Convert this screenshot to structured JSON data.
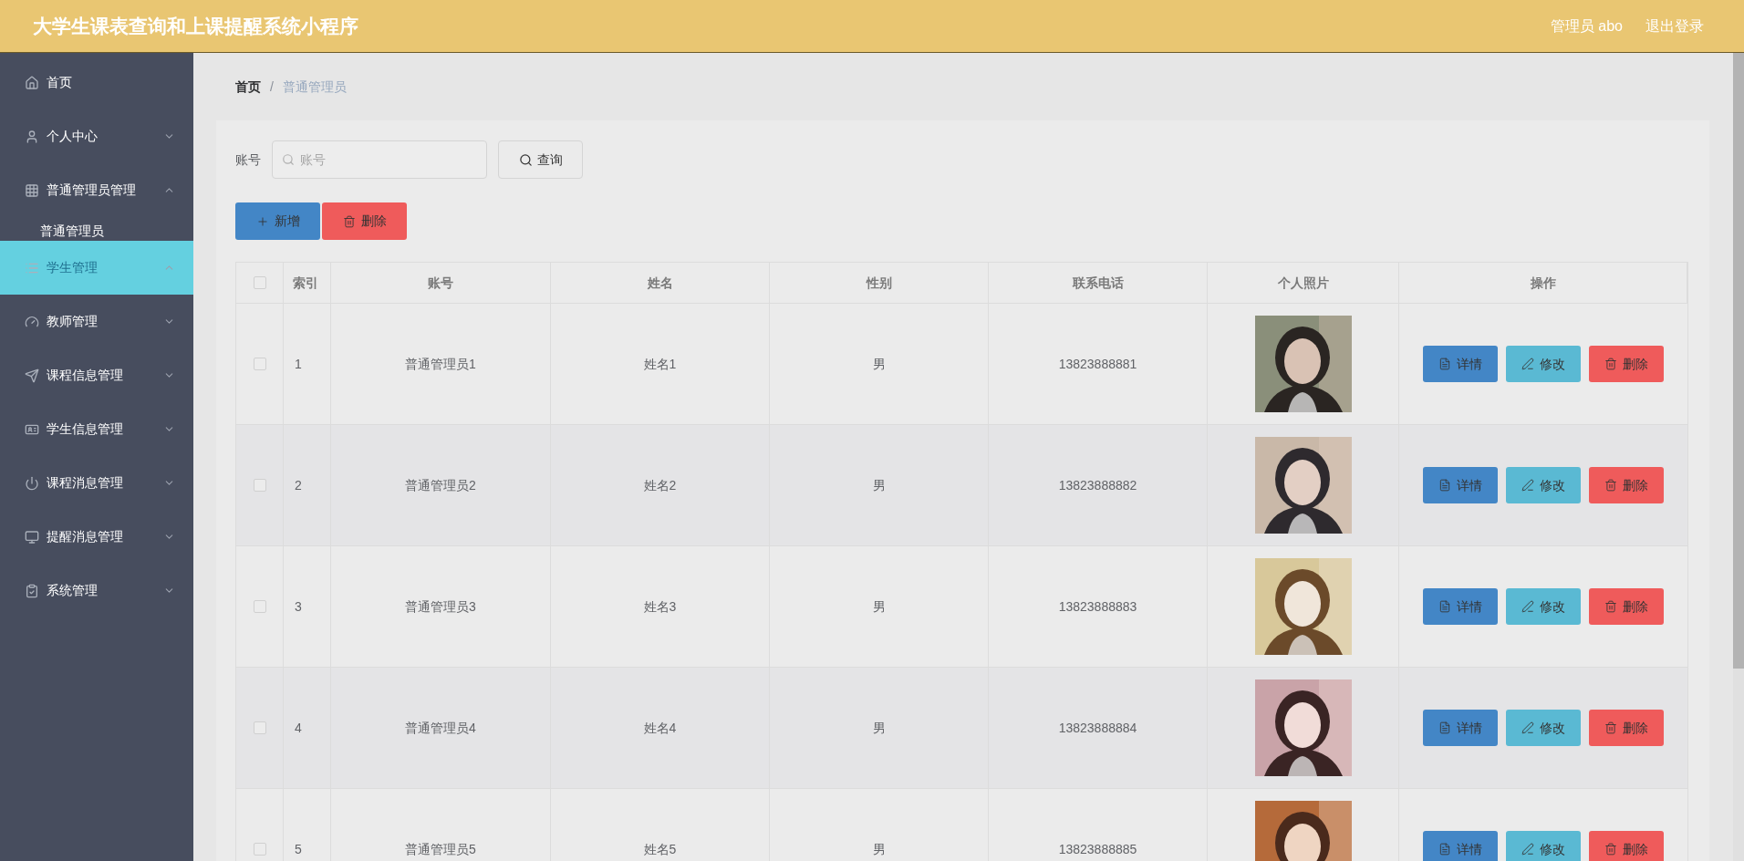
{
  "header": {
    "title": "大学生课表查询和上课提醒系统小程序",
    "user": "管理员 abo",
    "logout": "退出登录"
  },
  "sidebar": {
    "items": [
      {
        "label": "首页",
        "selected": false
      },
      {
        "label": "个人中心",
        "selected": false,
        "expanded": false
      },
      {
        "label": "普通管理员管理",
        "selected": false,
        "expanded": true,
        "children": [
          {
            "label": "普通管理员",
            "selected": false
          }
        ]
      },
      {
        "label": "学生管理",
        "selected": true,
        "expanded": true
      },
      {
        "label": "教师管理",
        "selected": false,
        "expanded": false
      },
      {
        "label": "课程信息管理",
        "selected": false,
        "expanded": false
      },
      {
        "label": "学生信息管理",
        "selected": false,
        "expanded": false
      },
      {
        "label": "课程消息管理",
        "selected": false,
        "expanded": false
      },
      {
        "label": "提醒消息管理",
        "selected": false,
        "expanded": false
      },
      {
        "label": "系统管理",
        "selected": false,
        "expanded": false
      }
    ]
  },
  "breadcrumb": {
    "items": [
      "首页",
      "普通管理员"
    ],
    "separator": "/"
  },
  "search": {
    "label": "账号",
    "placeholder": "账号",
    "button": "查询"
  },
  "toolbar": [
    {
      "label": "新增",
      "kind": "add"
    },
    {
      "label": "删除",
      "kind": "delete"
    }
  ],
  "table": {
    "header_checked": false,
    "columns": [
      "索引",
      "账号",
      "姓名",
      "性别",
      "联系电话",
      "个人照片",
      "操作"
    ],
    "rows": [
      {
        "checked": false,
        "index": "1",
        "account": "普通管理员1",
        "name": "姓名1",
        "gender": "男",
        "phone": "13823888881",
        "actions": [
          {
            "label": "详情",
            "kind": "detail"
          },
          {
            "label": "修改",
            "kind": "edit"
          },
          {
            "label": "删除",
            "kind": "delete"
          }
        ]
      },
      {
        "checked": false,
        "index": "2",
        "account": "普通管理员2",
        "name": "姓名2",
        "gender": "男",
        "phone": "13823888882",
        "actions": [
          {
            "label": "详情",
            "kind": "detail"
          },
          {
            "label": "修改",
            "kind": "edit"
          },
          {
            "label": "删除",
            "kind": "delete"
          }
        ]
      },
      {
        "checked": false,
        "index": "3",
        "account": "普通管理员3",
        "name": "姓名3",
        "gender": "男",
        "phone": "13823888883",
        "actions": [
          {
            "label": "详情",
            "kind": "detail"
          },
          {
            "label": "修改",
            "kind": "edit"
          },
          {
            "label": "删除",
            "kind": "delete"
          }
        ]
      },
      {
        "checked": false,
        "index": "4",
        "account": "普通管理员4",
        "name": "姓名4",
        "gender": "男",
        "phone": "13823888884",
        "actions": [
          {
            "label": "详情",
            "kind": "detail"
          },
          {
            "label": "修改",
            "kind": "edit"
          },
          {
            "label": "删除",
            "kind": "delete"
          }
        ]
      },
      {
        "checked": false,
        "index": "5",
        "account": "普通管理员5",
        "name": "姓名5",
        "gender": "男",
        "phone": "13823888885",
        "actions": [
          {
            "label": "详情",
            "kind": "detail"
          },
          {
            "label": "修改",
            "kind": "edit"
          },
          {
            "label": "删除",
            "kind": "delete"
          }
        ]
      }
    ]
  }
}
